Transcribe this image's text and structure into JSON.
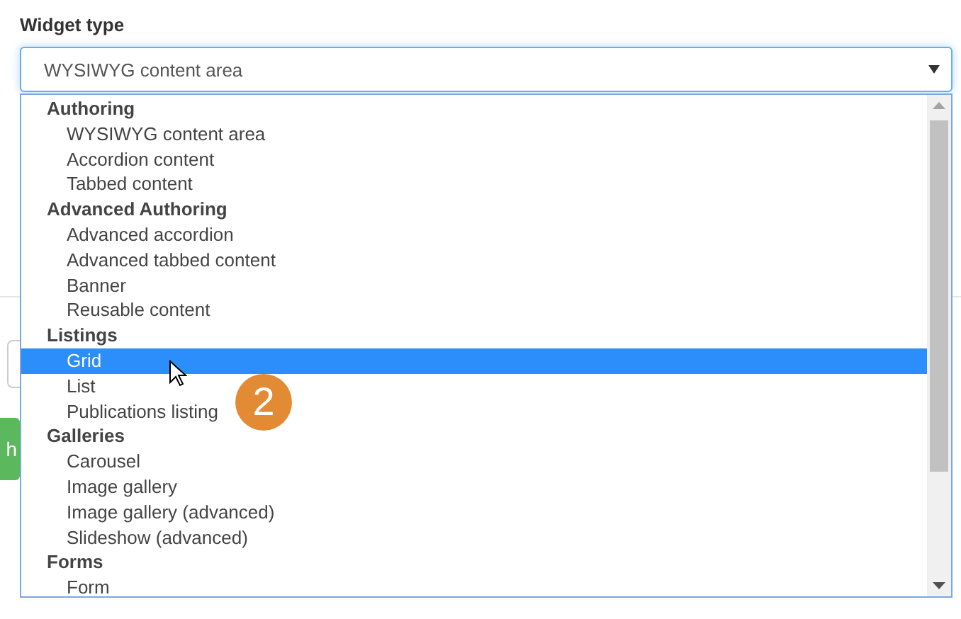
{
  "field_label": "Widget type",
  "select": {
    "value": "WYSIWYG content area"
  },
  "groups": [
    {
      "label": "Authoring",
      "options": [
        {
          "label": "WYSIWYG content area",
          "selected": false
        },
        {
          "label": "Accordion content",
          "selected": false
        },
        {
          "label": "Tabbed content",
          "selected": false
        }
      ]
    },
    {
      "label": "Advanced Authoring",
      "options": [
        {
          "label": "Advanced accordion",
          "selected": false
        },
        {
          "label": "Advanced tabbed content",
          "selected": false
        },
        {
          "label": "Banner",
          "selected": false
        },
        {
          "label": "Reusable content",
          "selected": false
        }
      ]
    },
    {
      "label": "Listings",
      "options": [
        {
          "label": "Grid",
          "selected": true
        },
        {
          "label": "List",
          "selected": false
        },
        {
          "label": "Publications listing",
          "selected": false
        }
      ]
    },
    {
      "label": "Galleries",
      "options": [
        {
          "label": "Carousel",
          "selected": false
        },
        {
          "label": "Image gallery",
          "selected": false
        },
        {
          "label": "Image gallery (advanced)",
          "selected": false
        },
        {
          "label": "Slideshow (advanced)",
          "selected": false
        }
      ]
    },
    {
      "label": "Forms",
      "options": [
        {
          "label": "Form",
          "selected": false
        }
      ]
    }
  ],
  "background_button": "h",
  "step_badge": "2"
}
